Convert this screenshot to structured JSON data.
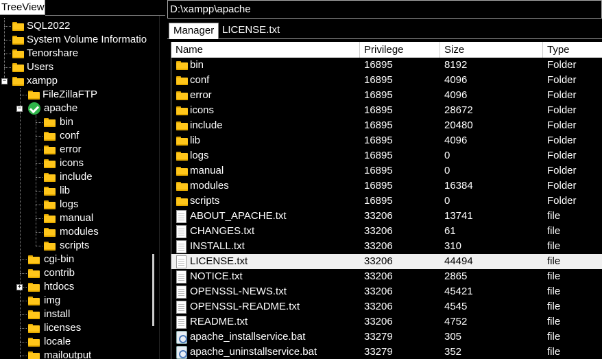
{
  "tree_panel": {
    "header": "TreeView"
  },
  "tree": [
    {
      "label": "SQL2022"
    },
    {
      "label": "System Volume Informatio"
    },
    {
      "label": "Tenorshare"
    },
    {
      "label": "Users"
    },
    {
      "label": "xampp"
    },
    {
      "label": "FileZillaFTP"
    },
    {
      "label": "apache"
    },
    {
      "label": "bin"
    },
    {
      "label": "conf"
    },
    {
      "label": "error"
    },
    {
      "label": "icons"
    },
    {
      "label": "include"
    },
    {
      "label": "lib"
    },
    {
      "label": "logs"
    },
    {
      "label": "manual"
    },
    {
      "label": "modules"
    },
    {
      "label": "scripts"
    },
    {
      "label": "cgi-bin"
    },
    {
      "label": "contrib"
    },
    {
      "label": "htdocs"
    },
    {
      "label": "img"
    },
    {
      "label": "install"
    },
    {
      "label": "licenses"
    },
    {
      "label": "locale"
    },
    {
      "label": "mailoutput"
    }
  ],
  "path": "D:\\xampp\\apache",
  "tabs": [
    {
      "label": "Manager"
    },
    {
      "label": "LICENSE.txt"
    }
  ],
  "columns": {
    "name": "Name",
    "privilege": "Privilege",
    "size": "Size",
    "type": "Type"
  },
  "files": [
    {
      "name": "bin",
      "privilege": "16895",
      "size": "8192",
      "type": "Folder",
      "icon": "folder-icon"
    },
    {
      "name": "conf",
      "privilege": "16895",
      "size": "4096",
      "type": "Folder",
      "icon": "folder-icon"
    },
    {
      "name": "error",
      "privilege": "16895",
      "size": "4096",
      "type": "Folder",
      "icon": "folder-icon"
    },
    {
      "name": "icons",
      "privilege": "16895",
      "size": "28672",
      "type": "Folder",
      "icon": "folder-icon"
    },
    {
      "name": "include",
      "privilege": "16895",
      "size": "20480",
      "type": "Folder",
      "icon": "folder-icon"
    },
    {
      "name": "lib",
      "privilege": "16895",
      "size": "4096",
      "type": "Folder",
      "icon": "folder-icon"
    },
    {
      "name": "logs",
      "privilege": "16895",
      "size": "0",
      "type": "Folder",
      "icon": "folder-icon"
    },
    {
      "name": "manual",
      "privilege": "16895",
      "size": "0",
      "type": "Folder",
      "icon": "folder-icon"
    },
    {
      "name": "modules",
      "privilege": "16895",
      "size": "16384",
      "type": "Folder",
      "icon": "folder-icon"
    },
    {
      "name": "scripts",
      "privilege": "16895",
      "size": "0",
      "type": "Folder",
      "icon": "folder-icon"
    },
    {
      "name": "ABOUT_APACHE.txt",
      "privilege": "33206",
      "size": "13741",
      "type": "file",
      "icon": "text-file-icon"
    },
    {
      "name": "CHANGES.txt",
      "privilege": "33206",
      "size": "61",
      "type": "file",
      "icon": "text-file-icon"
    },
    {
      "name": "INSTALL.txt",
      "privilege": "33206",
      "size": "310",
      "type": "file",
      "icon": "text-file-icon"
    },
    {
      "name": "LICENSE.txt",
      "privilege": "33206",
      "size": "44494",
      "type": "file",
      "icon": "text-file-icon",
      "selected": true
    },
    {
      "name": "NOTICE.txt",
      "privilege": "33206",
      "size": "2865",
      "type": "file",
      "icon": "text-file-icon"
    },
    {
      "name": "OPENSSL-NEWS.txt",
      "privilege": "33206",
      "size": "45421",
      "type": "file",
      "icon": "text-file-icon"
    },
    {
      "name": "OPENSSL-README.txt",
      "privilege": "33206",
      "size": "4545",
      "type": "file",
      "icon": "text-file-icon"
    },
    {
      "name": "README.txt",
      "privilege": "33206",
      "size": "4752",
      "type": "file",
      "icon": "text-file-icon"
    },
    {
      "name": "apache_installservice.bat",
      "privilege": "33279",
      "size": "305",
      "type": "file",
      "icon": "batch-file-icon"
    },
    {
      "name": "apache_uninstallservice.bat",
      "privilege": "33279",
      "size": "352",
      "type": "file",
      "icon": "batch-file-icon"
    }
  ]
}
